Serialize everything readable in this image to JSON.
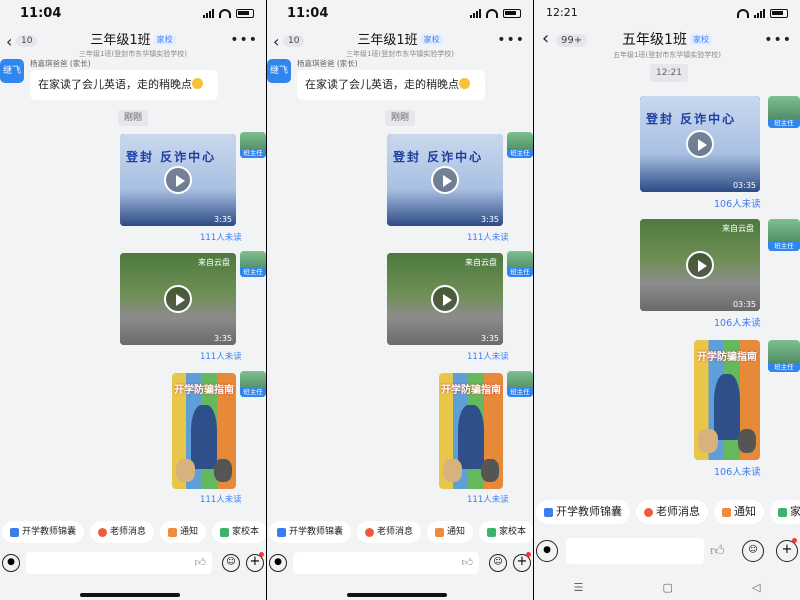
{
  "panel1": {
    "time": "11:04",
    "back_count": "10",
    "title": "三年级1班",
    "tag": "家校",
    "subtitle": "三年级1班(登封市东华镇实验学校)",
    "sender_avatar": "继飞",
    "sender_name": "杨嘉琪爸爸 (家长)",
    "message": "在家读了会儿英语，走的稍晚点",
    "timestamp": "刚刚",
    "video1": {
      "overlay": "登封 反诈中心",
      "duration": "3:35"
    },
    "video2": {
      "source": "来自云盘",
      "duration": "3:35"
    },
    "poster_title": "开学防骗指南",
    "unread": "111人未读",
    "teacher_label": "班主任"
  },
  "panel3": {
    "time": "12:21",
    "back_count": "99+",
    "title": "五年级1班",
    "tag": "家校",
    "subtitle": "五年级1班(登封市东华镇实验学校)",
    "timestamp": "12:21",
    "video1": {
      "overlay": "登封 反诈中心",
      "duration": "03:35"
    },
    "video2": {
      "source": "来自云盘",
      "duration": "03:35"
    },
    "poster_title": "开学防骗指南",
    "unread": "106人未读",
    "teacher_label": "班主任"
  },
  "quick": {
    "teacher_kit": "开学教师锦囊",
    "teacher_msg": "老师消息",
    "notice": "通知",
    "school_book": "家校本",
    "school_book_cut": "家"
  },
  "colors": {
    "accent": "#3c7cf0",
    "bg": "#f2f3f5"
  }
}
